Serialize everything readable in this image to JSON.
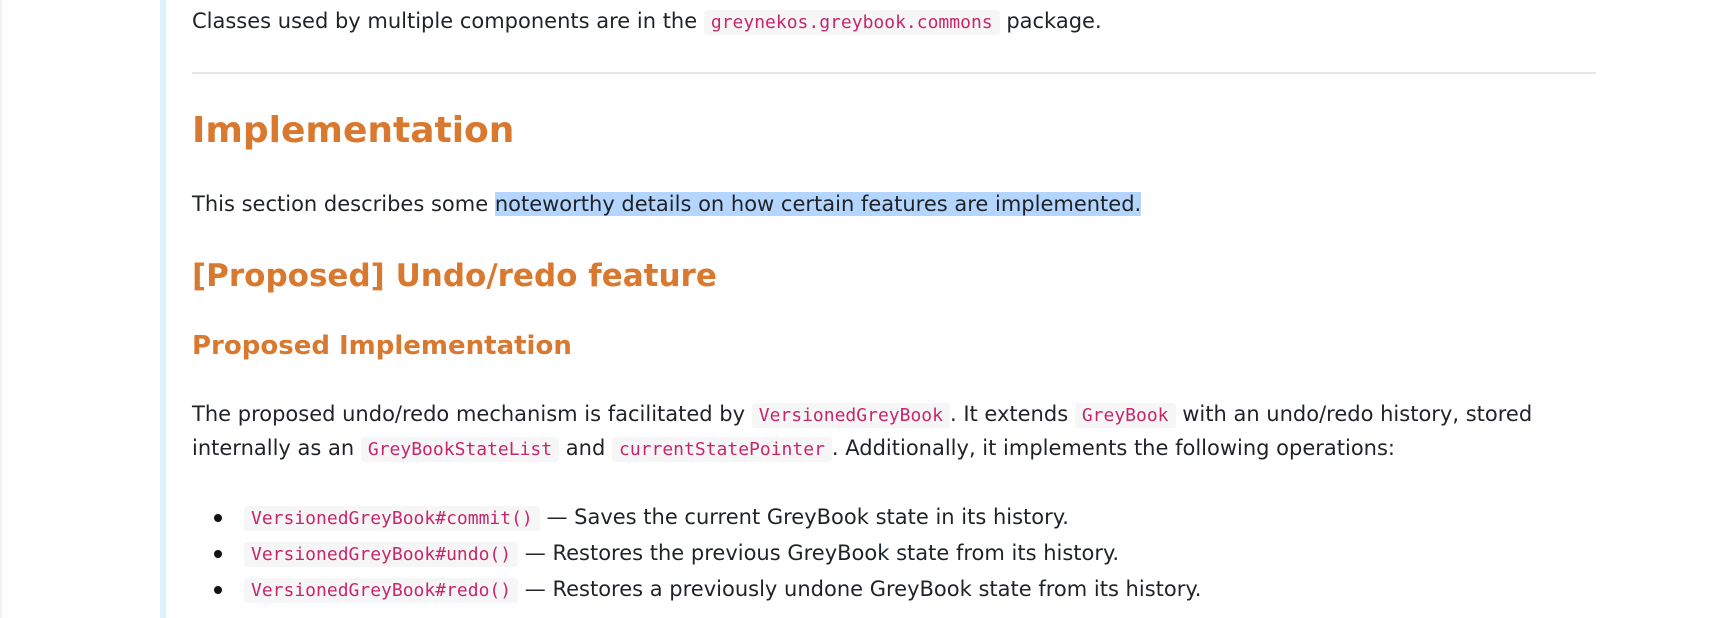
{
  "intro": {
    "before": "Classes used by multiple components are in the",
    "code": "greynekos.greybook.commons",
    "after": "package."
  },
  "implementation": {
    "title": "Implementation",
    "text_before": "This section describes some ",
    "text_highlighted": "noteworthy details on how certain features are implemented."
  },
  "undo_redo": {
    "title": "[Proposed] Undo/redo feature",
    "subtitle": "Proposed Implementation",
    "p_a": "The proposed undo/redo mechanism is facilitated by",
    "code_a": "VersionedGreyBook",
    "p_b": ". It extends",
    "code_b": "GreyBook",
    "p_c": "with an undo/redo history, stored internally as an",
    "code_c": "GreyBookStateList",
    "p_d": "and",
    "code_d": "currentStatePointer",
    "p_e": ". Additionally, it implements the following operations:",
    "operations": [
      {
        "code": "VersionedGreyBook#commit()",
        "text": "— Saves the current GreyBook state in its history."
      },
      {
        "code": "VersionedGreyBook#undo()",
        "text": "— Restores the previous GreyBook state from its history."
      },
      {
        "code": "VersionedGreyBook#redo()",
        "text": "— Restores a previously undone GreyBook state from its history."
      }
    ]
  }
}
